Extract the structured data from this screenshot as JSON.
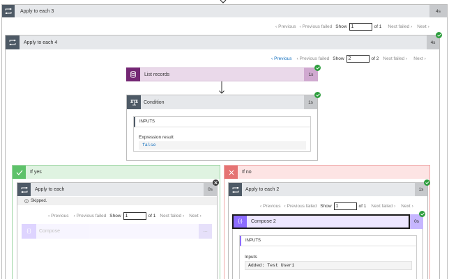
{
  "outer_loop": {
    "title": "Apply to each 3",
    "duration": "4s"
  },
  "pager_outer": {
    "previous": "Previous",
    "previous_failed": "Previous failed",
    "show": "Show",
    "value": "1",
    "of": "of 1",
    "next_failed": "Next failed",
    "next": "Next"
  },
  "loop4": {
    "title": "Apply to each 4",
    "duration": "4s"
  },
  "pager_loop4": {
    "previous": "Previous",
    "previous_failed": "Previous failed",
    "show": "Show",
    "value": "2",
    "of": "of 2",
    "next_failed": "Next failed",
    "next": "Next"
  },
  "list_records": {
    "title": "List records",
    "duration": "1s"
  },
  "condition": {
    "title": "Condition",
    "duration": "1s",
    "inputs_label": "INPUTS",
    "expression_label": "Expression result",
    "expression_value": "false"
  },
  "if_yes": {
    "title": "If yes"
  },
  "if_no": {
    "title": "If no"
  },
  "apply_each": {
    "title": "Apply to each",
    "duration": "0s",
    "status": "Skipped."
  },
  "pager_apply_each": {
    "previous": "Previous",
    "previous_failed": "Previous failed",
    "show": "Show",
    "value": "1",
    "of": "of 1",
    "next_failed": "Next failed",
    "next": "Next"
  },
  "compose_skipped": {
    "title": "Compose",
    "duration": "---"
  },
  "apply_each2": {
    "title": "Apply to each 2",
    "duration": "1s"
  },
  "pager_apply_each2": {
    "previous": "Previous",
    "previous_failed": "Previous failed",
    "show": "Show",
    "value": "1",
    "of": "of 1",
    "next_failed": "Next failed",
    "next": "Next"
  },
  "compose2": {
    "title": "Compose 2",
    "duration": "0s",
    "inputs_label": "INPUTS",
    "inputs_field": "Inputs",
    "inputs_value": "Added: Test User1"
  },
  "colors": {
    "loop_icon": "#4e5a66",
    "list_records_icon": "#742774",
    "condition_icon": "#4e5a66",
    "compose_icon": "#8c6cff",
    "success": "#2e9e3e",
    "yes_branch": "#5ec26a",
    "no_branch": "#e57373"
  }
}
